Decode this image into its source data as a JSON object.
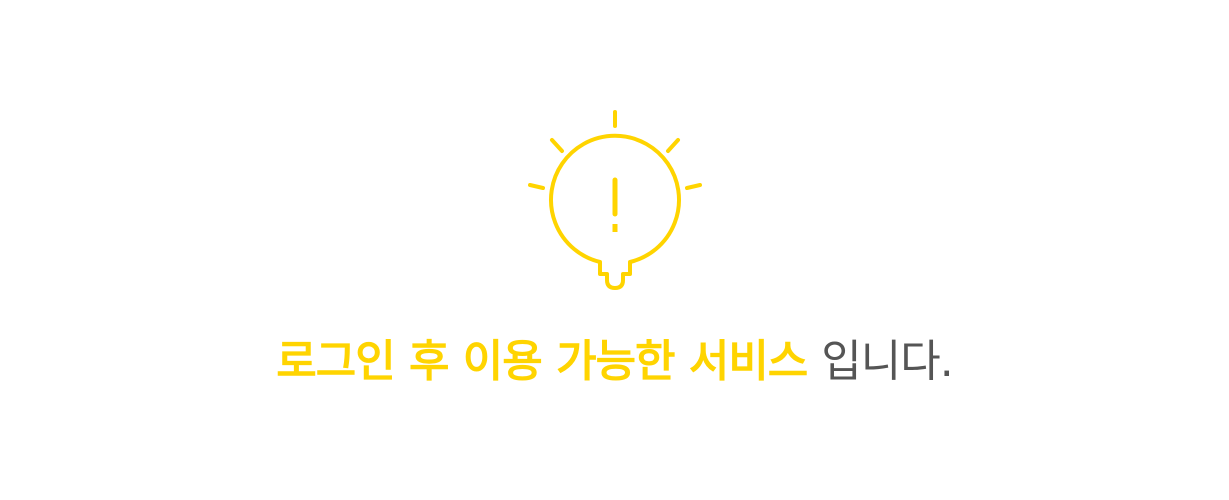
{
  "colors": {
    "accent": "#ffd400",
    "text": "#555555",
    "background": "#ffffff"
  },
  "icon": {
    "name": "lightbulb-exclamation-icon"
  },
  "message": {
    "highlight": "로그인 후 이용 가능한 서비스",
    "rest": "입니다."
  }
}
